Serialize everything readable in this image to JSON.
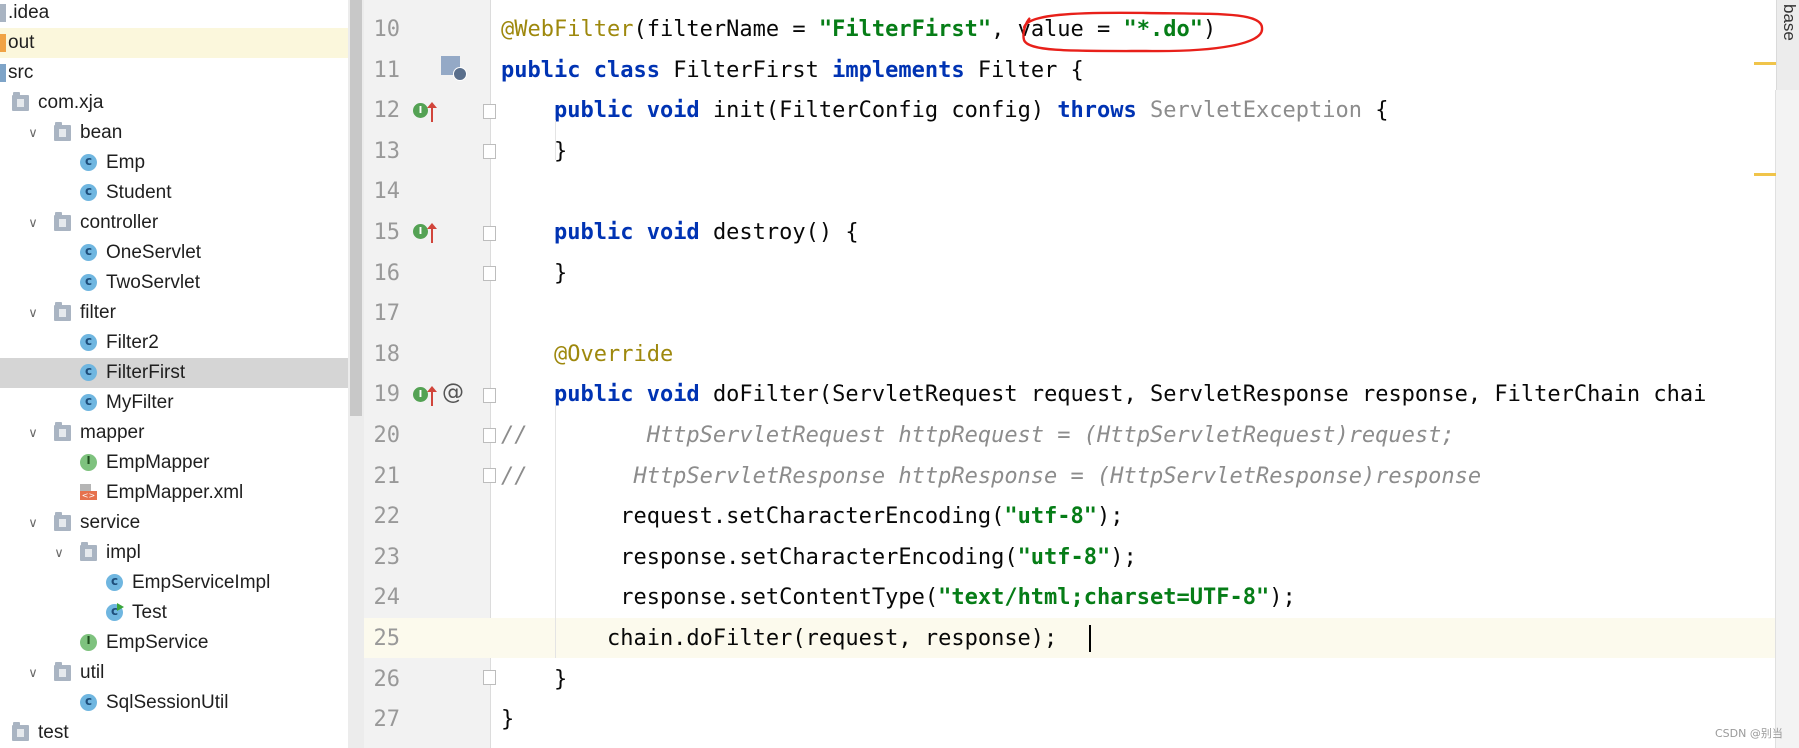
{
  "tree": {
    "items": [
      {
        "label": ".idea",
        "kind": "module",
        "indent": 0,
        "chevron": ""
      },
      {
        "label": "out",
        "kind": "out",
        "indent": 0,
        "chevron": "",
        "highlight": true
      },
      {
        "label": "src",
        "kind": "src",
        "indent": 0,
        "chevron": ""
      },
      {
        "label": "com.xja",
        "kind": "folder",
        "indent": 1,
        "chevron": ""
      },
      {
        "label": "bean",
        "kind": "folder",
        "indent": 1,
        "chevron": "∨"
      },
      {
        "label": "Emp",
        "kind": "class",
        "indent": 2,
        "chevron": ""
      },
      {
        "label": "Student",
        "kind": "class",
        "indent": 2,
        "chevron": ""
      },
      {
        "label": "controller",
        "kind": "folder",
        "indent": 1,
        "chevron": "∨"
      },
      {
        "label": "OneServlet",
        "kind": "class",
        "indent": 2,
        "chevron": ""
      },
      {
        "label": "TwoServlet",
        "kind": "class",
        "indent": 2,
        "chevron": ""
      },
      {
        "label": "filter",
        "kind": "folder",
        "indent": 1,
        "chevron": "∨"
      },
      {
        "label": "Filter2",
        "kind": "class",
        "indent": 2,
        "chevron": ""
      },
      {
        "label": "FilterFirst",
        "kind": "class",
        "indent": 2,
        "chevron": "",
        "selected": true
      },
      {
        "label": "MyFilter",
        "kind": "class",
        "indent": 2,
        "chevron": ""
      },
      {
        "label": "mapper",
        "kind": "folder",
        "indent": 1,
        "chevron": "∨"
      },
      {
        "label": "EmpMapper",
        "kind": "interface",
        "indent": 2,
        "chevron": ""
      },
      {
        "label": "EmpMapper.xml",
        "kind": "xml",
        "indent": 2,
        "chevron": ""
      },
      {
        "label": "service",
        "kind": "folder",
        "indent": 1,
        "chevron": "∨"
      },
      {
        "label": "impl",
        "kind": "folder",
        "indent": 2,
        "chevron": "∨"
      },
      {
        "label": "EmpServiceImpl",
        "kind": "class",
        "indent": 3,
        "chevron": ""
      },
      {
        "label": "Test",
        "kind": "class-run",
        "indent": 3,
        "chevron": ""
      },
      {
        "label": "EmpService",
        "kind": "interface",
        "indent": 2,
        "chevron": ""
      },
      {
        "label": "util",
        "kind": "folder",
        "indent": 1,
        "chevron": "∨"
      },
      {
        "label": "SqlSessionUtil",
        "kind": "class",
        "indent": 2,
        "chevron": ""
      },
      {
        "label": "test",
        "kind": "folder",
        "indent": 0,
        "chevron": ""
      }
    ]
  },
  "editor": {
    "lines": [
      {
        "num": "10",
        "tokens": [
          [
            "ann",
            "@WebFilter"
          ],
          [
            "",
            "(filterName = "
          ],
          [
            "str",
            "\"FilterFirst\""
          ],
          [
            "",
            ", value = "
          ],
          [
            "str",
            "\"*.do\""
          ],
          [
            "",
            ")"
          ]
        ]
      },
      {
        "num": "11",
        "tokens": [
          [
            "kw",
            "public class "
          ],
          [
            "",
            "FilterFirst "
          ],
          [
            "kw",
            "implements "
          ],
          [
            "",
            "Filter {"
          ]
        ]
      },
      {
        "num": "12",
        "tokens": [
          [
            "",
            "    "
          ],
          [
            "kw",
            "public void "
          ],
          [
            "",
            "init(FilterConfig config) "
          ],
          [
            "kw",
            "throws "
          ],
          [
            "gray",
            "ServletException"
          ],
          [
            "",
            " {"
          ]
        ]
      },
      {
        "num": "13",
        "tokens": [
          [
            "",
            "    }"
          ]
        ]
      },
      {
        "num": "14",
        "tokens": []
      },
      {
        "num": "15",
        "tokens": [
          [
            "",
            "    "
          ],
          [
            "kw",
            "public void "
          ],
          [
            "",
            "destroy() {"
          ]
        ]
      },
      {
        "num": "16",
        "tokens": [
          [
            "",
            "    }"
          ]
        ]
      },
      {
        "num": "17",
        "tokens": []
      },
      {
        "num": "18",
        "tokens": [
          [
            "",
            "    "
          ],
          [
            "ann",
            "@Override"
          ]
        ]
      },
      {
        "num": "19",
        "tokens": [
          [
            "",
            "    "
          ],
          [
            "kw",
            "public void "
          ],
          [
            "",
            "doFilter(ServletRequest request, ServletResponse response, FilterChain chai"
          ]
        ]
      },
      {
        "num": "20",
        "tokens": [
          [
            "cmt",
            "//         HttpServletRequest httpRequest = (HttpServletRequest)request;"
          ]
        ]
      },
      {
        "num": "21",
        "tokens": [
          [
            "cmt",
            "//        HttpServletResponse httpResponse = (HttpServletResponse)response"
          ]
        ]
      },
      {
        "num": "22",
        "tokens": [
          [
            "",
            "         request.setCharacterEncoding("
          ],
          [
            "str",
            "\"utf-8\""
          ],
          [
            "",
            ");"
          ]
        ]
      },
      {
        "num": "23",
        "tokens": [
          [
            "",
            "         response.setCharacterEncoding("
          ],
          [
            "str",
            "\"utf-8\""
          ],
          [
            "",
            ");"
          ]
        ]
      },
      {
        "num": "24",
        "tokens": [
          [
            "",
            "         response.setContentType("
          ],
          [
            "str",
            "\"text/html;charset=UTF-8\""
          ],
          [
            "",
            ");"
          ]
        ]
      },
      {
        "num": "25",
        "tokens": [
          [
            "",
            "        chain.doFilter(request, response);"
          ]
        ],
        "current": true
      },
      {
        "num": "26",
        "tokens": [
          [
            "",
            "    }"
          ]
        ]
      },
      {
        "num": "27",
        "tokens": [
          [
            "",
            "}"
          ]
        ]
      }
    ],
    "gutter_at": "@"
  },
  "side_panel": {
    "label": "base"
  },
  "watermark": "CSDN @别当"
}
